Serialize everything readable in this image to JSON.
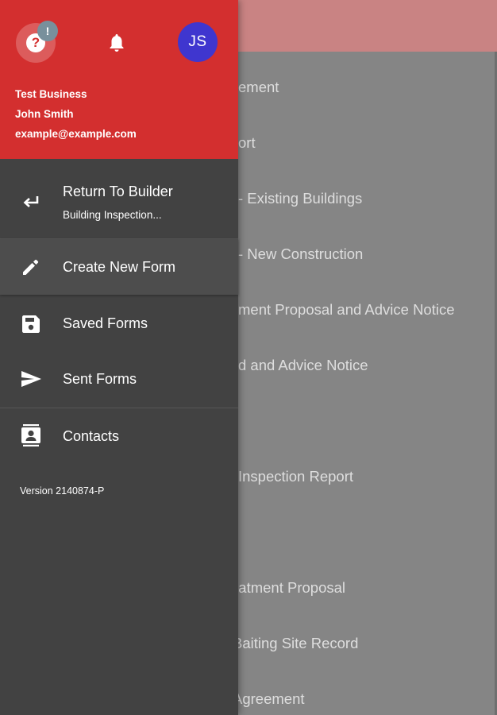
{
  "background": {
    "list_items": [
      "ement",
      "ort",
      "- Existing Buildings",
      "- New Construction",
      "ment Proposal and Advice Notice",
      "d and Advice Notice",
      "",
      "Inspection Report",
      "",
      "eatment Proposal",
      "Baiting Site Record",
      "Agreement"
    ]
  },
  "drawer": {
    "header": {
      "help_icon": "help-circle-icon",
      "help_glyph": "?",
      "help_badge": "!",
      "bell_icon": "bell-icon",
      "avatar_initials": "JS",
      "business_name": "Test Business",
      "user_name": "John Smith",
      "email": "example@example.com"
    },
    "items": [
      {
        "icon": "return-icon",
        "label": "Return To Builder",
        "sublabel": "Building Inspection..."
      },
      {
        "icon": "pencil-icon",
        "label": "Create New Form"
      },
      {
        "icon": "save-icon",
        "label": "Saved Forms"
      },
      {
        "icon": "send-icon",
        "label": "Sent Forms"
      },
      {
        "icon": "contacts-icon",
        "label": "Contacts"
      }
    ],
    "version": "Version 2140874-P"
  },
  "colors": {
    "header_red": "#d32f2f",
    "drawer_bg": "#424242",
    "avatar_blue": "#3f36cf",
    "badge_gray": "#78909c"
  }
}
